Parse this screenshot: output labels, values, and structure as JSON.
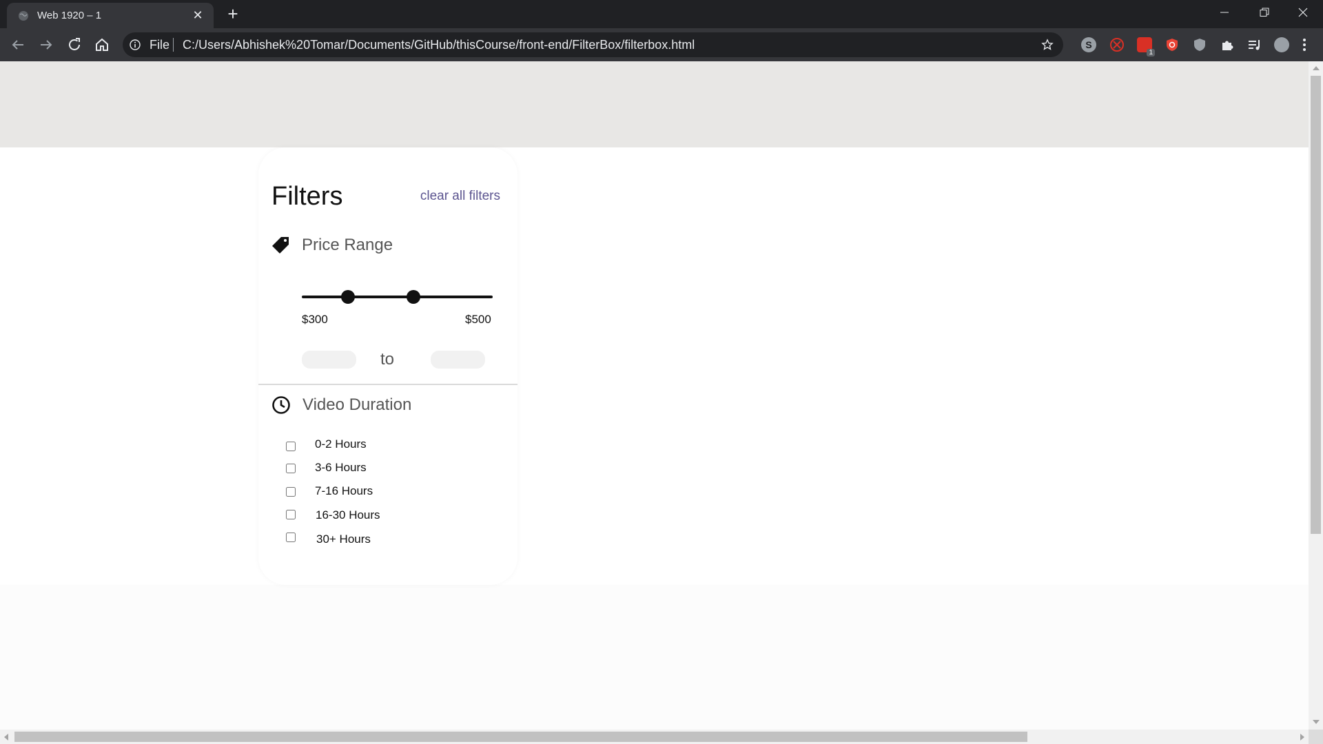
{
  "browser": {
    "tab_title": "Web 1920 – 1",
    "url_scheme": "File",
    "url": "C:/Users/Abhishek%20Tomar/Documents/GitHub/thisCourse/front-end/FilterBox/filterbox.html",
    "extension_badge": "1"
  },
  "filters": {
    "title": "Filters",
    "clear_label": "clear all filters",
    "price": {
      "title": "Price Range",
      "min_label": "$300",
      "max_label": "$500",
      "to_label": "to",
      "min_input": "",
      "max_input": ""
    },
    "duration": {
      "title": "Video Duration",
      "options": [
        {
          "label": "0-2 Hours",
          "checked": false
        },
        {
          "label": "3-6 Hours",
          "checked": false
        },
        {
          "label": "7-16 Hours",
          "checked": false
        },
        {
          "label": "16-30 Hours",
          "checked": false
        },
        {
          "label": "30+ Hours",
          "checked": false
        }
      ]
    }
  },
  "colors": {
    "chrome_dark": "#202124",
    "toolbar": "#35363a",
    "hero_band": "#e8e7e5",
    "link": "#5c5590"
  },
  "icons": [
    "globe-icon",
    "close-icon",
    "plus-icon",
    "minimize-icon",
    "restore-icon",
    "back-icon",
    "forward-icon",
    "reload-icon",
    "home-icon",
    "info-icon",
    "star-icon",
    "price-tag-icon",
    "clock-icon",
    "puzzle-icon",
    "menu-dots-icon"
  ]
}
